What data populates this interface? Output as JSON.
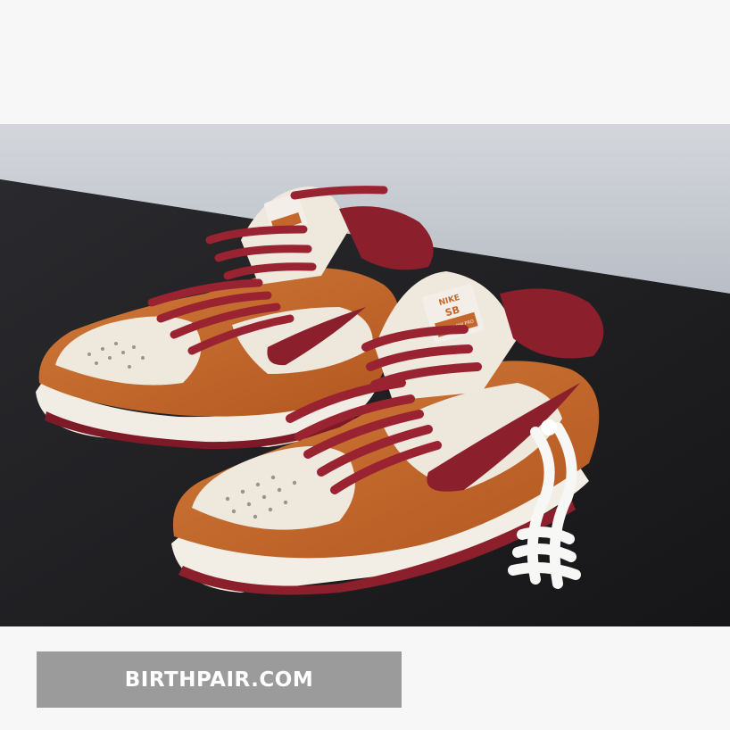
{
  "photo": {
    "subject": "pair of low-top sneakers",
    "tongue_label": [
      "NIKE",
      "SB",
      "DUNK LOW PRO"
    ]
  },
  "watermark": {
    "text": "BIRTHPAIR.COM"
  },
  "colors": {
    "background": "#f7f7f7",
    "wall": "#c9cdd3",
    "table": "#1f1f22",
    "suede_orange": "#c4672c",
    "burgundy": "#8c1f2c",
    "cream": "#eee7dc",
    "watermark_bar": "#9b9b9b"
  }
}
